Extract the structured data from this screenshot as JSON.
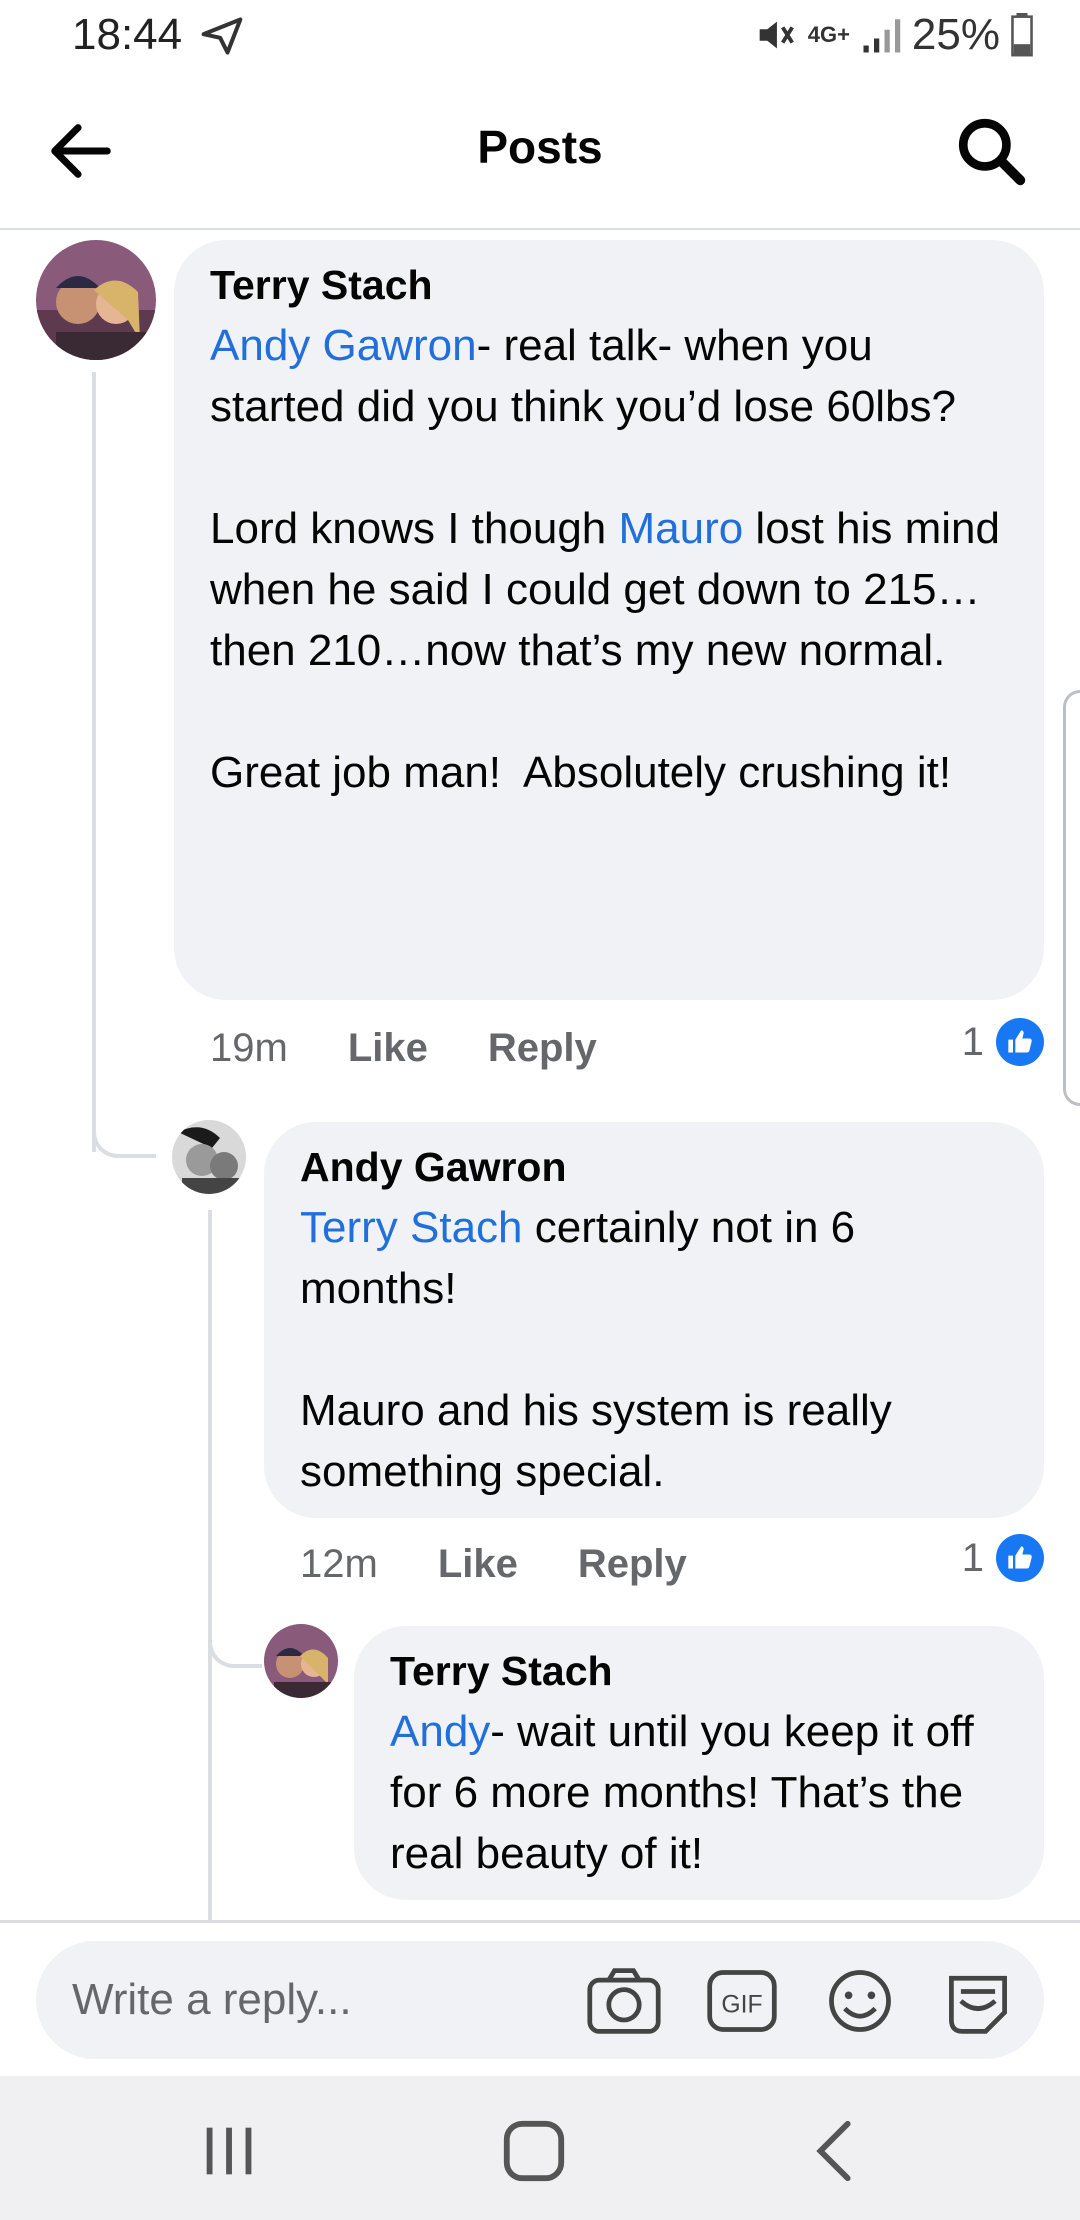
{
  "status_bar": {
    "time": "18:44",
    "network": "4G+",
    "battery": "25%"
  },
  "header": {
    "title": "Posts"
  },
  "comments": [
    {
      "author": "Terry Stach",
      "mention": "Andy Gawron",
      "text_1": "- real talk- when you started did you think you’d lose 60lbs?\n\nLord knows I though ",
      "mention_2": "Mauro",
      "text_2": " lost his mind when he said I could get down to 215…then 210…now that’s my new normal.\n\nGreat job man!  Absolutely crushing it!",
      "time": "19m",
      "like": "Like",
      "reply": "Reply",
      "reactions": "1"
    },
    {
      "author": "Andy Gawron",
      "mention": "Terry Stach",
      "text_1": " certainly not in 6 months!\n\nMauro and his system is really something special.",
      "time": "12m",
      "like": "Like",
      "reply": "Reply",
      "reactions": "1"
    },
    {
      "author": "Terry Stach",
      "mention": "Andy",
      "text_1": "- wait until you keep it off for 6 more months! That’s the real beauty of it!"
    }
  ],
  "composer": {
    "placeholder": "Write a reply..."
  },
  "icons": [
    "telegram-send-icon",
    "mute-icon",
    "signal-icon",
    "battery-icon",
    "back-arrow-icon",
    "search-icon",
    "like-icon",
    "camera-icon",
    "gif-icon",
    "emoji-icon",
    "sticker-icon",
    "recents-icon",
    "home-icon",
    "back-icon"
  ],
  "colors": {
    "mention": "#216fdb",
    "bubble": "#f0f2f5",
    "like_blue": "#1877f2"
  }
}
